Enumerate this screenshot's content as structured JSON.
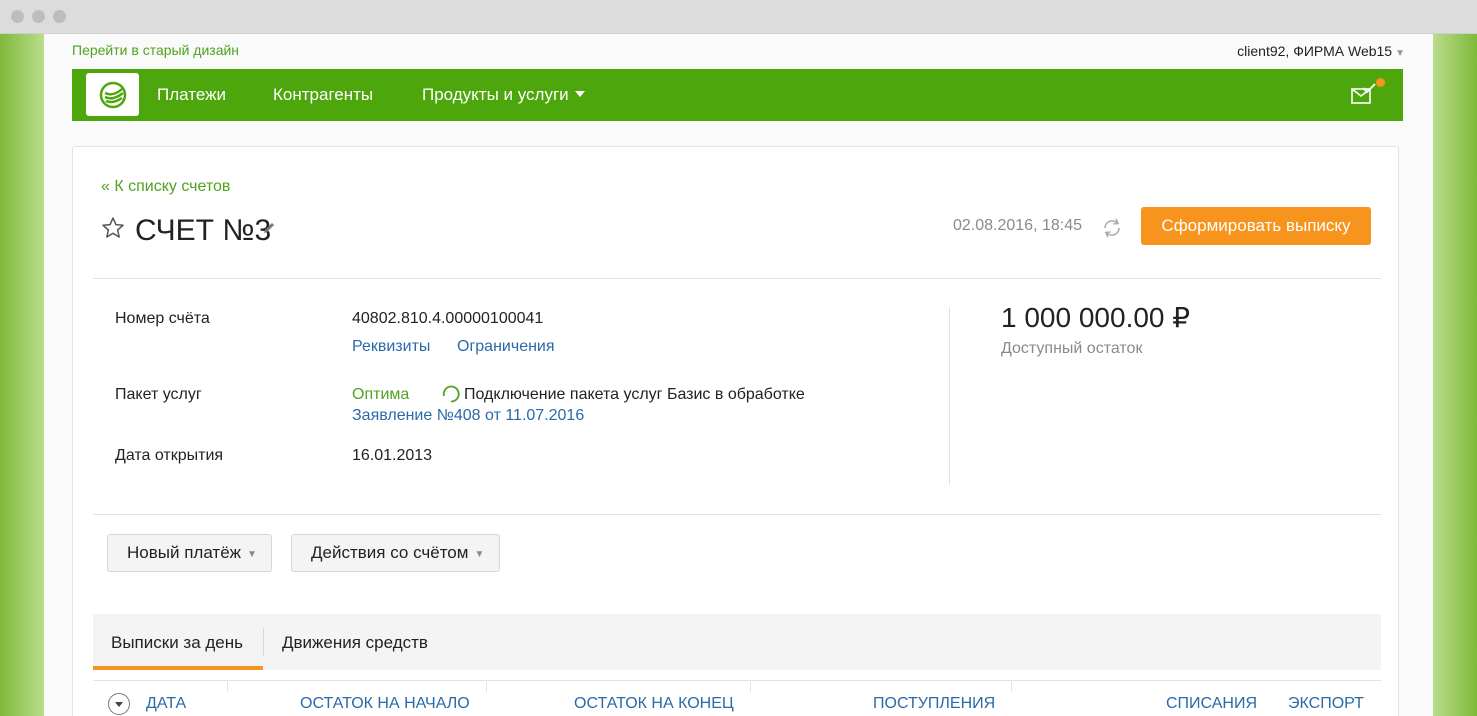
{
  "top_bar": {
    "old_design_link": "Перейти в старый дизайн",
    "user_label": "client92, ФИРМА Web15"
  },
  "nav": {
    "items": [
      {
        "label": "Платежи"
      },
      {
        "label": "Контрагенты"
      },
      {
        "label": "Продукты и услуги"
      }
    ],
    "brand_color": "#4da70c",
    "notification_color": "#f7941d"
  },
  "account": {
    "back_link": "« К списку счетов",
    "title": "СЧЕТ №3",
    "datetime": "02.08.2016, 18:45",
    "statement_button": "Сформировать выписку",
    "fields": {
      "number_label": "Номер счёта",
      "number_value": "40802.810.4.00000100041",
      "requisites_link": "Реквизиты",
      "restrictions_link": "Ограничения",
      "package_label": "Пакет услуг",
      "package_value": "Оптима",
      "package_status": "Подключение пакета услуг Базис в обработке",
      "application_link": "Заявление №408 от 11.07.2016",
      "open_date_label": "Дата открытия",
      "open_date_value": "16.01.2013"
    },
    "balance": {
      "amount": "1 000 000.00 ₽",
      "caption": "Доступный остаток"
    }
  },
  "actions": {
    "new_payment": "Новый платёж",
    "account_actions": "Действия со счётом"
  },
  "tabs": [
    {
      "label": "Выписки за день",
      "active": true
    },
    {
      "label": "Движения средств",
      "active": false
    }
  ],
  "table": {
    "columns": [
      "ДАТА",
      "ОСТАТОК НА НАЧАЛО",
      "ОСТАТОК НА КОНЕЦ",
      "ПОСТУПЛЕНИЯ",
      "СПИСАНИЯ",
      "ЭКСПОРТ"
    ]
  },
  "icons": {
    "logo": "bank-logo-icon",
    "star": "star-icon",
    "edit": "pencil-icon",
    "refresh": "refresh-icon",
    "mail": "mail-check-icon",
    "spinner": "loading-spinner-icon"
  }
}
